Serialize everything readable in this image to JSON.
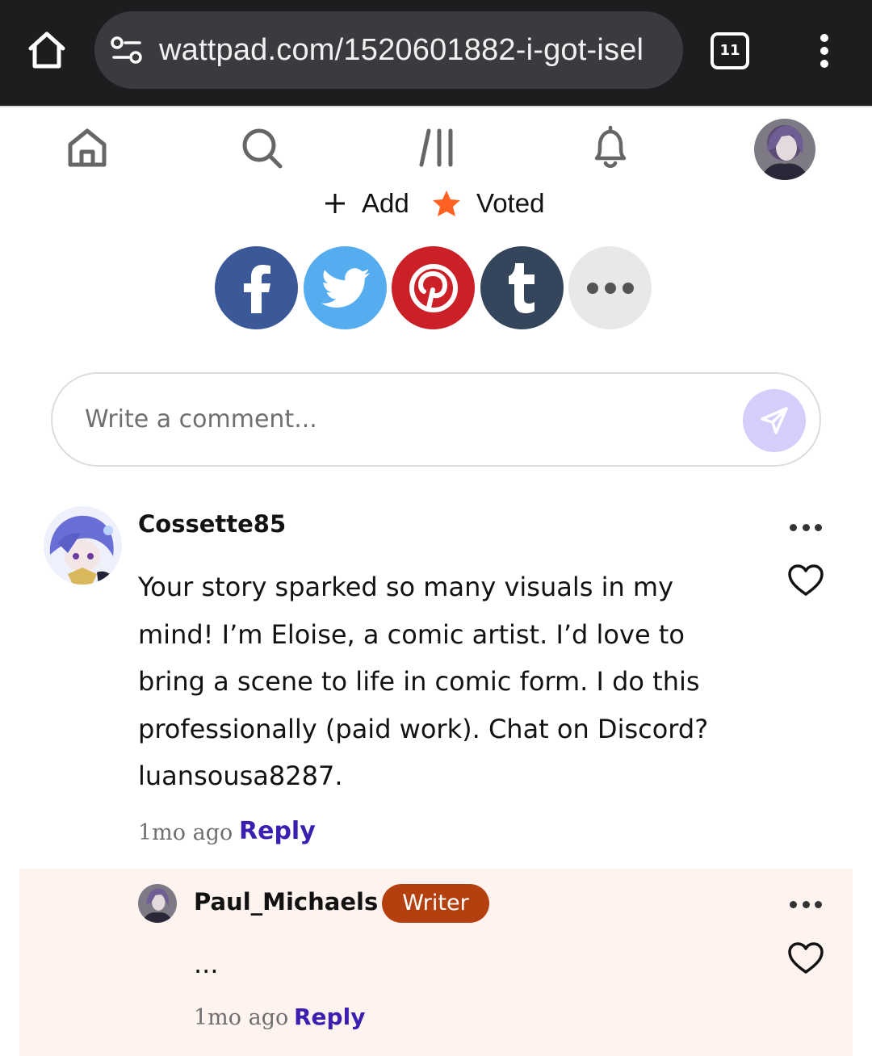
{
  "browser": {
    "url": "wattpad.com/1520601882-i-got-isel",
    "tab_count": "11",
    "icons": [
      "home-icon",
      "site-settings-icon",
      "tabs-icon",
      "more-vert-icon"
    ]
  },
  "nav": {
    "icons": [
      "home-icon",
      "search-icon",
      "library-icon",
      "notifications-icon",
      "profile-avatar"
    ]
  },
  "actions": {
    "add_label": "Add",
    "voted_label": "Voted",
    "star_color": "#ff6122"
  },
  "share": {
    "buttons": [
      {
        "name": "facebook",
        "color": "#3b5998",
        "glyph": "f"
      },
      {
        "name": "twitter",
        "color": "#55acee"
      },
      {
        "name": "pinterest",
        "color": "#cb2027"
      },
      {
        "name": "tumblr",
        "color": "#35465c",
        "glyph": "t"
      },
      {
        "name": "more",
        "color": "#e8e8e8"
      }
    ]
  },
  "comment_input": {
    "placeholder": "Write a comment..."
  },
  "comments": [
    {
      "username": "Cossette85",
      "text": "Your story sparked so many visuals in my mind! I’m Eloise, a comic artist. I’d love to bring a scene to life in comic form. I do this professionally (paid work). Chat on Discord? luansousa8287.",
      "time": "1mo ago",
      "reply_label": "Reply"
    }
  ],
  "reply": {
    "username": "Paul_Michaels",
    "badge": "Writer",
    "badge_color": "#b5400f",
    "text": "...",
    "time": "1mo ago",
    "reply_label": "Reply"
  },
  "colors": {
    "reply_link": "#3a1fb0",
    "reply_background": "#fff3ef",
    "send_button": "#d6cdfb"
  }
}
